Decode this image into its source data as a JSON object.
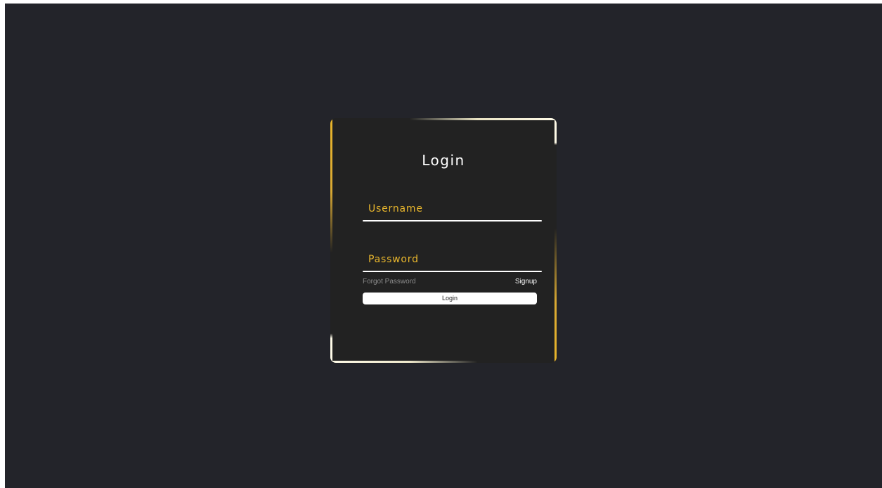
{
  "login_form": {
    "title": "Login",
    "username": {
      "placeholder": "Username"
    },
    "password": {
      "placeholder": "Password"
    },
    "forgot_password_label": "Forgot Password",
    "signup_label": "Signup",
    "login_button_label": "Login"
  },
  "colors": {
    "background": "#23242a",
    "card": "#222222",
    "accent": "#e8b62d",
    "glow": "#fffbe8",
    "text": "#ffffff",
    "muted_text": "#8b8b8b"
  }
}
